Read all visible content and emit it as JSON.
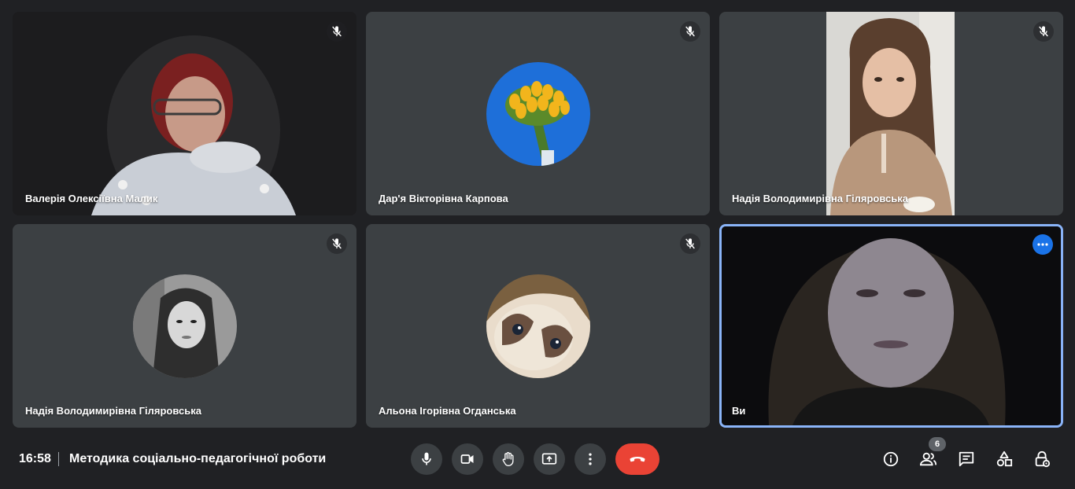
{
  "participants": [
    {
      "name": "Валерія Олексіївна Малик",
      "muted": true,
      "view": "video"
    },
    {
      "name": "Дар'я Вікторівна Карпова",
      "muted": true,
      "view": "avatar"
    },
    {
      "name": "Надія Володимирівна Гіляровська",
      "muted": true,
      "view": "video"
    },
    {
      "name": "Надія Володимирівна Гіляровська",
      "muted": true,
      "view": "avatar"
    },
    {
      "name": "Альона Ігорівна Огданська",
      "muted": true,
      "view": "avatar"
    },
    {
      "name": "Ви",
      "muted": false,
      "view": "video",
      "self": true
    }
  ],
  "footer": {
    "time": "16:58",
    "meeting_title": "Методика соціально-педагогічної роботи",
    "people_count": "6"
  },
  "icons": {
    "mic": "mic-icon",
    "camera": "camera-icon",
    "hand": "raise-hand-icon",
    "present": "present-icon",
    "more": "more-vert-icon",
    "end": "end-call-icon",
    "info": "info-icon",
    "people": "people-icon",
    "chat": "chat-icon",
    "activities": "activities-icon",
    "lock": "host-controls-icon"
  },
  "colors": {
    "background": "#202124",
    "tile": "#3c4043",
    "accent": "#1a73e8",
    "end_call": "#ea4335",
    "speaker_border": "#8ab4f8"
  }
}
